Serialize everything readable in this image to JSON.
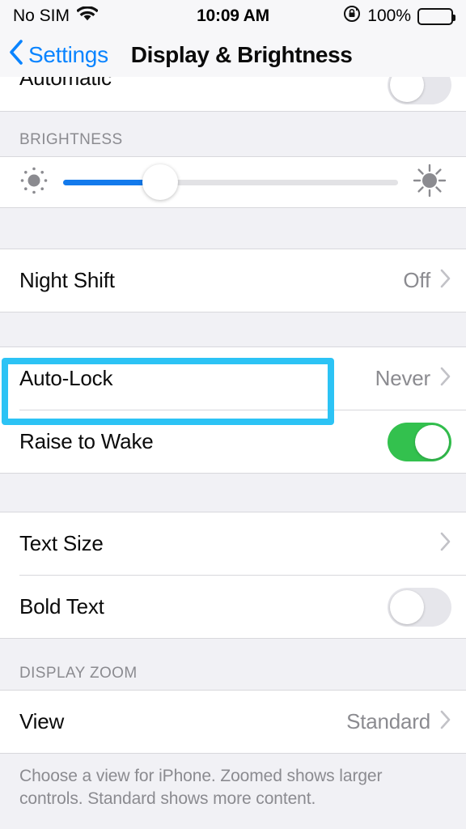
{
  "status_bar": {
    "carrier": "No SIM",
    "wifi_icon": "wifi-icon",
    "time": "10:09 AM",
    "rotation_lock_icon": "rotation-lock-icon",
    "battery_percent": "100%",
    "battery_icon": "battery-full-icon"
  },
  "nav": {
    "back_label": "Settings",
    "back_icon": "chevron-left-icon",
    "title": "Display & Brightness"
  },
  "rows": {
    "automatic": {
      "label": "Automatic",
      "toggle": "off"
    },
    "night_shift": {
      "label": "Night Shift",
      "value": "Off"
    },
    "auto_lock": {
      "label": "Auto-Lock",
      "value": "Never"
    },
    "raise_to_wake": {
      "label": "Raise to Wake",
      "toggle": "on"
    },
    "text_size": {
      "label": "Text Size",
      "value": ""
    },
    "bold_text": {
      "label": "Bold Text",
      "toggle": "off"
    },
    "view": {
      "label": "View",
      "value": "Standard"
    }
  },
  "sections": {
    "brightness_header": "BRIGHTNESS",
    "display_zoom_header": "DISPLAY ZOOM",
    "display_zoom_footer": "Choose a view for iPhone. Zoomed shows larger controls. Standard shows more content."
  },
  "brightness_slider": {
    "value_percent": 29,
    "low_icon": "sun-small-icon",
    "high_icon": "sun-large-icon",
    "fill_color": "#137aec",
    "track_color": "#e2e2e5"
  },
  "highlight": {
    "target": "auto-lock-row",
    "color": "#2cc3f5"
  },
  "colors": {
    "accent_blue": "#0a84ff",
    "toggle_on_green": "#33c14e",
    "value_gray": "#8b8b90",
    "group_bg": "#ffffff",
    "page_bg": "#f1f1f5"
  }
}
